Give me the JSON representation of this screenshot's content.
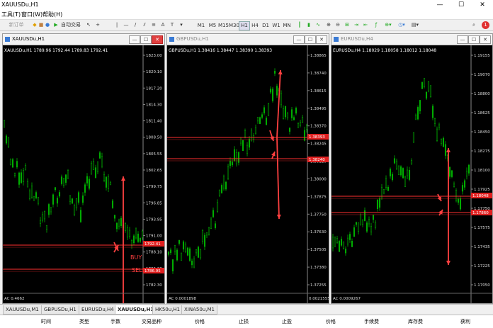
{
  "app": {
    "title": "XAUUSDu,H1",
    "minimize": "—",
    "maximize": "☐",
    "close": "✕"
  },
  "menu": [
    "工具(T)",
    "窗口(W)",
    "帮助(H)"
  ],
  "toolbar": {
    "new_order": "新订单",
    "auto_trading": "自动交易",
    "timeframes": [
      "M1",
      "M5",
      "M15",
      "M30",
      "H1",
      "H4",
      "D1",
      "W1",
      "MN"
    ],
    "active_tf": "H1"
  },
  "charts": [
    {
      "title": "XAUUSDu,H1",
      "ohlc": "XAUUSDu,H1  1789.96 1792.44 1789.83 1792.41",
      "active": true,
      "price_labels": [
        "1823.00",
        "1820.10",
        "1817.20",
        "1814.30",
        "1811.40",
        "1808.50",
        "1805.55",
        "1802.65",
        "1799.75",
        "1796.85",
        "1793.95",
        "1791.00",
        "1788.10",
        "1785.20",
        "1782.30"
      ],
      "tags": [
        "1792.41",
        "1786.95"
      ],
      "annotations": [
        "BUY",
        "SELL"
      ],
      "indicator": "AC 0.4662",
      "line_color": "#ff3c3c",
      "candle_color": "#00c000",
      "arrow_color": "#ff4040"
    },
    {
      "title": "GBPUSDu,H1",
      "ohlc": "GBPUSDu,H1  1.38416 1.38447 1.38390 1.38393",
      "active": false,
      "price_labels": [
        "1.38865",
        "1.38740",
        "1.38615",
        "1.38495",
        "1.38370",
        "1.38245",
        "1.38120",
        "1.38000",
        "1.37875",
        "1.37750",
        "1.37630",
        "1.37505",
        "1.37380",
        "1.37255"
      ],
      "tags": [
        "1.38393",
        "1.38240"
      ],
      "indicator": "AC 0.0001898",
      "indicator_value": "0.0021555"
    },
    {
      "title": "EURUSDu,H4",
      "ohlc": "EURUSDu,H4  1.18029 1.18058 1.18012 1.18048",
      "active": false,
      "price_labels": [
        "1.19155",
        "1.19070",
        "1.18800",
        "1.18625",
        "1.18450",
        "1.18275",
        "1.18100",
        "1.17925",
        "1.17750",
        "1.17575",
        "1.17435",
        "1.17225",
        "1.17050"
      ],
      "tags": [
        "1.18048",
        "1.17860"
      ],
      "indicator": "AC 0.0009267"
    }
  ],
  "tabs": [
    "XAUUSDu,M1",
    "GBPUSDu,H1",
    "EURUSDu,H4",
    "XAUUSDu,H1",
    "HK50u,H1",
    "XINA50u,M1"
  ],
  "active_tab": "XAUUSDu,H1",
  "columns": [
    "时间",
    "类型",
    "手数",
    "交易品种",
    "价格",
    "止损",
    "止盈",
    "价格",
    "手续费",
    "库存费",
    "获利"
  ]
}
